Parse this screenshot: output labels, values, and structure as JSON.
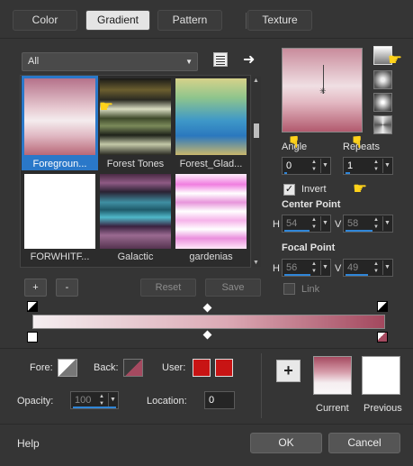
{
  "tabs": [
    "Color",
    "Gradient",
    "Pattern",
    "Texture"
  ],
  "active_tab": "Gradient",
  "filter": {
    "value": "All"
  },
  "gradients": [
    {
      "name": "Foregroun...",
      "selected": true
    },
    {
      "name": "Forest Tones",
      "selected": false
    },
    {
      "name": "Forest_Glad...",
      "selected": false
    },
    {
      "name": "FORWHITF...",
      "selected": false
    },
    {
      "name": "Galactic",
      "selected": false
    },
    {
      "name": "gardenias",
      "selected": false
    }
  ],
  "list_buttons": {
    "add": "+",
    "remove": "-",
    "reset": "Reset",
    "save": "Save"
  },
  "angle": {
    "label": "Angle",
    "value": "0"
  },
  "repeats": {
    "label": "Repeats",
    "value": "1"
  },
  "invert": {
    "label": "Invert",
    "checked": true
  },
  "center_point": {
    "label": "Center Point",
    "h_label": "H",
    "h": "54",
    "v_label": "V",
    "v": "58"
  },
  "focal_point": {
    "label": "Focal Point",
    "h_label": "H",
    "h": "56",
    "v_label": "V",
    "v": "49"
  },
  "link": {
    "label": "Link",
    "checked": false
  },
  "bottom": {
    "fore_label": "Fore:",
    "back_label": "Back:",
    "user_label": "User:",
    "opacity_label": "Opacity:",
    "opacity": "100",
    "location_label": "Location:",
    "location": "0",
    "add_button": "+",
    "current_label": "Current",
    "previous_label": "Previous"
  },
  "footer": {
    "help": "Help",
    "ok": "OK",
    "cancel": "Cancel"
  },
  "colors": {
    "accent": "#2f86d8",
    "gradient_light": "#f2e8ea",
    "gradient_mid": "#c98391",
    "gradient_dark": "#a54a60",
    "user_color": "#c81414"
  }
}
